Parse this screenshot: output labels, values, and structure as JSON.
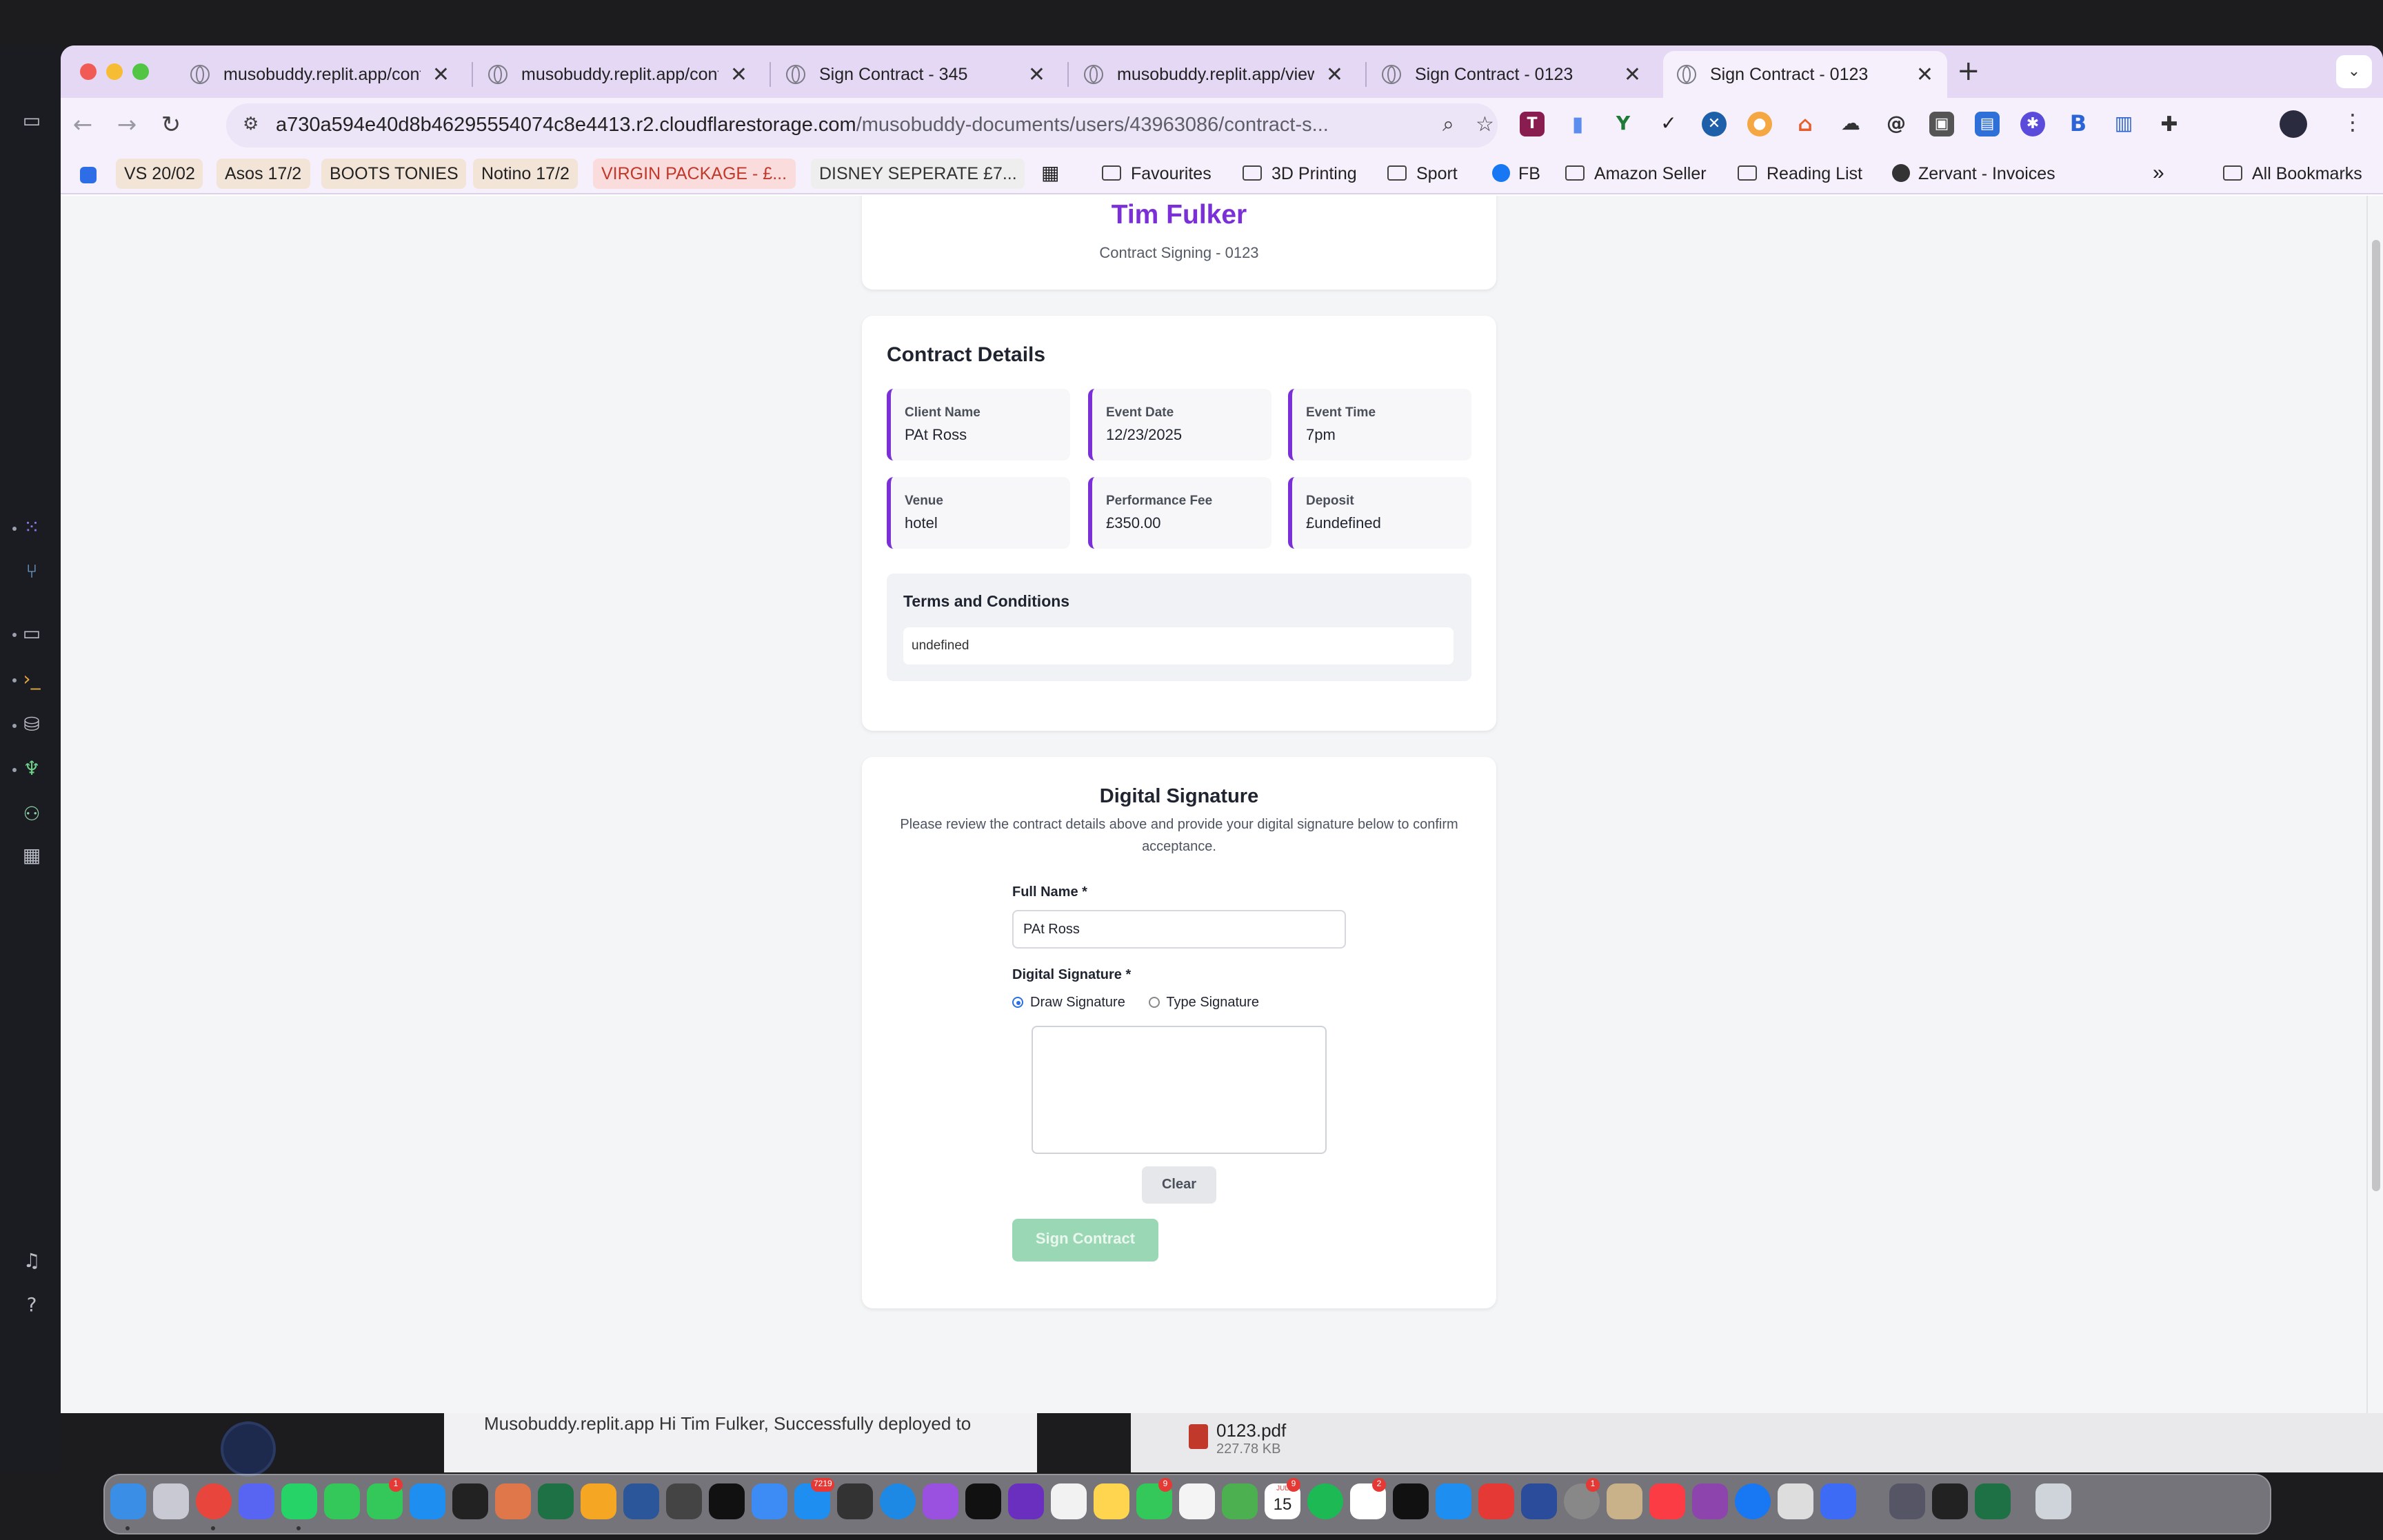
{
  "browser": {
    "tabs": [
      {
        "title": "musobuddy.replit.app/contra",
        "close": "✕"
      },
      {
        "title": "musobuddy.replit.app/contra",
        "close": "✕"
      },
      {
        "title": "Sign Contract - 345",
        "close": "✕"
      },
      {
        "title": "musobuddy.replit.app/view-c",
        "close": "✕"
      },
      {
        "title": "Sign Contract - 0123",
        "close": "✕"
      },
      {
        "title": "Sign Contract - 0123",
        "close": "✕"
      }
    ],
    "new_tab": "+",
    "url_host": "a730a594e40d8b46295554074c8e4413.r2.cloudflarestorage.com",
    "url_path": "/musobuddy-documents/users/43963086/contract-s...",
    "bookmarks": [
      {
        "label": "VS 20/02"
      },
      {
        "label": "Asos 17/2"
      },
      {
        "label": "BOOTS TONIES"
      },
      {
        "label": "Notino 17/2"
      },
      {
        "label": "VIRGIN PACKAGE - £..."
      },
      {
        "label": "DISNEY SEPERATE £7..."
      },
      {
        "label": "Favourites"
      },
      {
        "label": "3D Printing"
      },
      {
        "label": "Sport"
      },
      {
        "label": "FB"
      },
      {
        "label": "Amazon Seller"
      },
      {
        "label": "Reading List"
      },
      {
        "label": "Zervant - Invoices"
      },
      {
        "label": "All Bookmarks"
      }
    ],
    "more_bookmarks": "»"
  },
  "page": {
    "header": {
      "name": "Tim Fulker",
      "subtitle": "Contract Signing - 0123"
    },
    "details": {
      "title": "Contract Details",
      "fields": [
        {
          "label": "Client Name",
          "value": "PAt Ross"
        },
        {
          "label": "Event Date",
          "value": "12/23/2025"
        },
        {
          "label": "Event Time",
          "value": "7pm"
        },
        {
          "label": "Venue",
          "value": "hotel"
        },
        {
          "label": "Performance Fee",
          "value": "£350.00"
        },
        {
          "label": "Deposit",
          "value": "£undefined"
        }
      ],
      "terms_title": "Terms and Conditions",
      "terms_value": "undefined"
    },
    "signature": {
      "title": "Digital Signature",
      "description": "Please review the contract details above and provide your digital signature below to confirm acceptance.",
      "full_name_label": "Full Name *",
      "full_name_value": "PAt Ross",
      "signature_label": "Digital Signature *",
      "draw_option": "Draw Signature",
      "type_option": "Type Signature",
      "clear_label": "Clear",
      "sign_label": "Sign Contract"
    }
  },
  "background": {
    "mail_preview": "Musobuddy.replit.app Hi Tim Fulker, Successfully deployed to",
    "file_name": "0123.pdf",
    "file_size": "227.78 KB"
  },
  "dock": {
    "calendar_day": "15",
    "calendar_month": "JUL"
  },
  "colors": {
    "accent": "#7b2fd6",
    "tabbar": "#e4d8f5",
    "sign_button": "#9ad8b5"
  }
}
